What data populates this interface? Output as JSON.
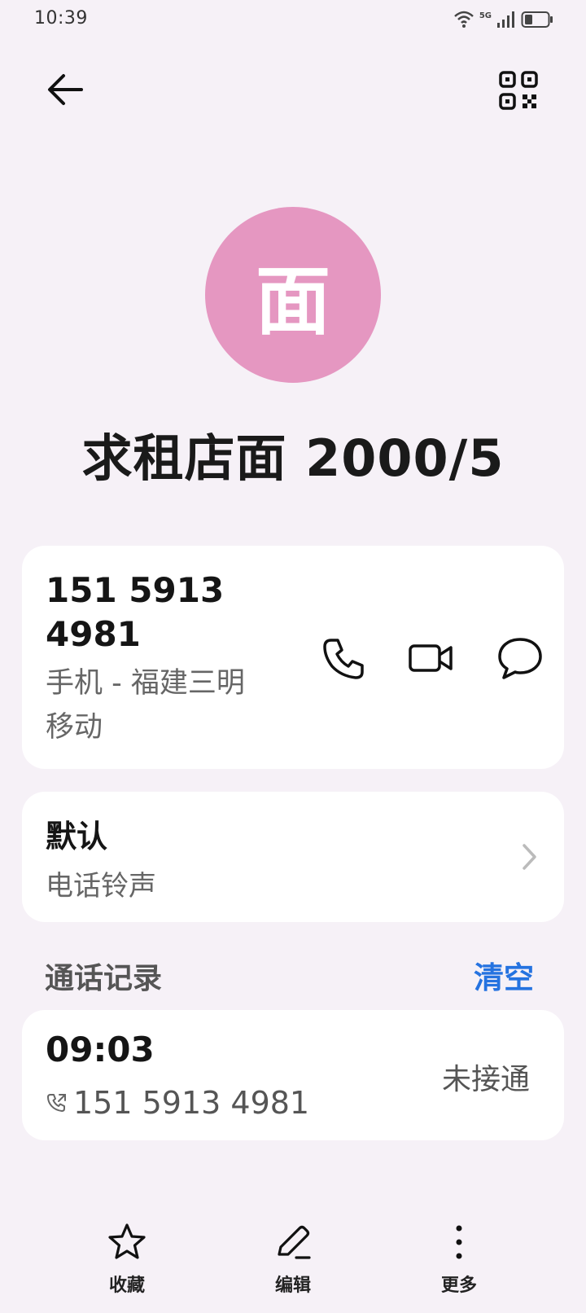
{
  "status_bar": {
    "time": "10:39",
    "network_label": "5G",
    "icons": [
      "wifi-icon",
      "signal-icon",
      "battery-icon"
    ]
  },
  "header": {
    "back_icon": "arrow-left-icon",
    "qr_icon": "qr-code-icon"
  },
  "contact": {
    "avatar_letter": "面",
    "avatar_color": "#e597c1",
    "name": "求租店面 2000/5"
  },
  "phone": {
    "number_line1": "151 5913",
    "number_line2": "4981",
    "label_line1": "手机 - 福建三明",
    "label_line2": "移动",
    "actions": [
      "phone-icon",
      "video-icon",
      "message-icon"
    ]
  },
  "ringtone": {
    "title": "默认",
    "subtitle": "电话铃声"
  },
  "call_log": {
    "section_title": "通话记录",
    "clear_label": "清空",
    "accent": "#2573e0",
    "entries": [
      {
        "time": "09:03",
        "number": "151 5913 4981",
        "status": "未接通"
      }
    ]
  },
  "bottom_bar": {
    "favorite_label": "收藏",
    "edit_label": "编辑",
    "more_label": "更多"
  }
}
